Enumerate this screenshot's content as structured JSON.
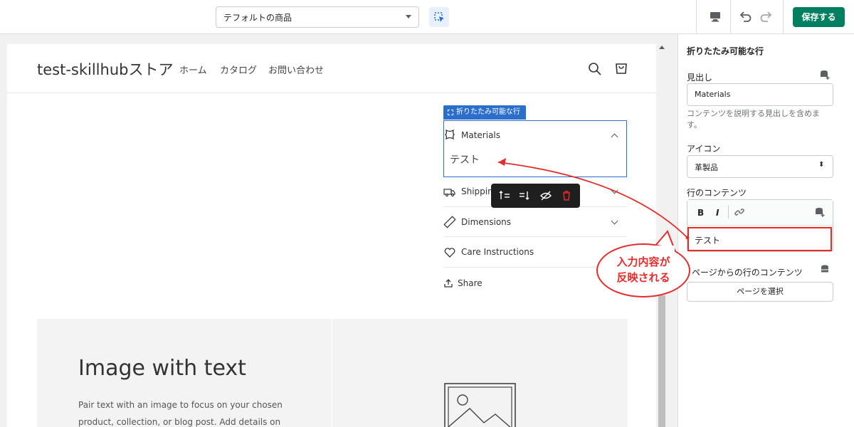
{
  "topbar": {
    "template_select_value": "テフォルトの商品",
    "save_label": "保存する"
  },
  "store": {
    "name": "test-skillhubストア",
    "nav": [
      "ホーム",
      "カタログ",
      "お問い合わせ"
    ]
  },
  "collapsible": {
    "tag": "折りたたみ可能な行",
    "rows": [
      {
        "label": "Materials",
        "icon": "leather-icon"
      },
      {
        "label": "Shippin",
        "icon": "truck-icon"
      },
      {
        "label": "Dimensions",
        "icon": "ruler-icon"
      },
      {
        "label": "Care Instructions",
        "icon": "heart-icon"
      }
    ],
    "open_content": "テスト",
    "share_label": "Share"
  },
  "image_with_text": {
    "title": "Image with text",
    "body_lines": [
      "Pair text with an image to focus on your chosen",
      "product, collection, or blog post. Add details on"
    ]
  },
  "panel": {
    "title": "折りたたみ可能な行",
    "heading_label": "見出し",
    "heading_value": "Materials",
    "heading_help_1": "コンテンツを説明する見出しを含めま",
    "heading_help_2": "す。",
    "icon_label": "アイコン",
    "icon_value": "革製品",
    "content_label": "行のコンテンツ",
    "rte_bold": "B",
    "rte_italic": "I",
    "content_value": "テスト",
    "page_content_label": "ページからの行のコンテンツ",
    "select_page_label": "ページを選択"
  },
  "annotation": {
    "line1": "入力内容が",
    "line2": "反映される",
    "color": "#e32c2b"
  },
  "colors": {
    "accent": "#2c6ecb",
    "save": "#008060"
  }
}
